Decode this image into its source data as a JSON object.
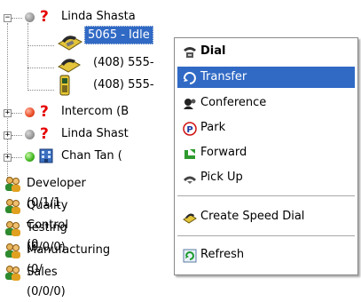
{
  "tree": {
    "contact": {
      "name": "Linda Shasta",
      "status": "unknown",
      "lines": [
        {
          "label": "5065 - Idle",
          "selected": true
        },
        {
          "label": "(408) 555-",
          "selected": false
        },
        {
          "label": "(408) 555-",
          "selected": false
        }
      ]
    },
    "contacts": [
      {
        "label": "Intercom (B",
        "status": "red"
      },
      {
        "label": "Linda Shast",
        "status": "grey"
      },
      {
        "label": "Chan Tan (",
        "status": "green"
      }
    ],
    "groups": [
      {
        "label": "Developer  (0/1/1"
      },
      {
        "label": "Quality Control  (0"
      },
      {
        "label": "Testing  (0/0/0)"
      },
      {
        "label": "Manufacturing  (0/"
      },
      {
        "label": "Sales  (0/0/0)"
      }
    ]
  },
  "context_menu": {
    "items": [
      {
        "label": "Dial",
        "icon": "dial-icon",
        "bold": true,
        "highlighted": false
      },
      {
        "label": "Transfer",
        "icon": "transfer-icon",
        "bold": false,
        "highlighted": true
      },
      {
        "label": "Conference",
        "icon": "conference-icon",
        "bold": false,
        "highlighted": false
      },
      {
        "label": "Park",
        "icon": "park-icon",
        "bold": false,
        "highlighted": false
      },
      {
        "label": "Forward",
        "icon": "forward-icon",
        "bold": false,
        "highlighted": false
      },
      {
        "label": "Pick Up",
        "icon": "pickup-icon",
        "bold": false,
        "highlighted": false
      }
    ],
    "items2": [
      {
        "label": "Create Speed Dial",
        "icon": "speed-dial-icon"
      }
    ],
    "items3": [
      {
        "label": "Refresh",
        "icon": "refresh-icon"
      }
    ]
  },
  "colors": {
    "selection": "#316ac5",
    "question_mark": "#e60000"
  }
}
